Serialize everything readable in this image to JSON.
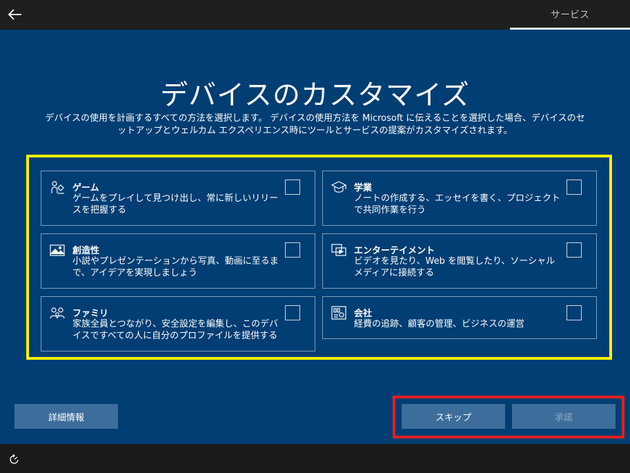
{
  "header": {
    "tab_label": "サービス",
    "back_icon": "back-arrow-icon"
  },
  "main": {
    "title": "デバイスのカスタマイズ",
    "description": "デバイスの使用を計画するすべての方法を選択します。 デバイスの使用方法を Microsoft に伝えることを選択した場合、デバイスのセットアップとウェルカム エクスペリエンス時にツールとサービスの提案がカスタマイズされます。",
    "background_color": "#003e73",
    "cards": [
      {
        "title": "ゲーム",
        "description": "ゲームをプレイして見つけ出し、常に新しいリリースを把握する",
        "icon": "gaming-icon",
        "checked": false
      },
      {
        "title": "学業",
        "description": "ノートの作成する、エッセイを書く、プロジェクトで共同作業を行う",
        "icon": "school-icon",
        "checked": false
      },
      {
        "title": "創造性",
        "description": "小説やプレゼンテーションから写真、動画に至るまで、アイデアを実現しましょう",
        "icon": "picture-icon",
        "checked": false
      },
      {
        "title": "エンターテイメント",
        "description": "ビデオを見たり、Web を閲覧したり、ソーシャル メディアに接続する",
        "icon": "entertainment-icon",
        "checked": false
      },
      {
        "title": "ファミリ",
        "description": "家族全員とつながり、安全設定を編集し、このデバイスですべての人に自分のプロファイルを提供する",
        "icon": "family-icon",
        "checked": false
      },
      {
        "title": "会社",
        "description": "経費の追跡、顧客の管理、ビジネスの運営",
        "icon": "business-icon",
        "checked": false
      }
    ]
  },
  "footer": {
    "more_info_label": "詳細情報",
    "skip_label": "スキップ",
    "accept_label": "承諾"
  },
  "bottombar": {
    "accessibility_icon": "accessibility-icon"
  },
  "colors": {
    "highlight_yellow": "#fff200",
    "highlight_red": "#e0201f",
    "button": "#3c6d9b"
  }
}
